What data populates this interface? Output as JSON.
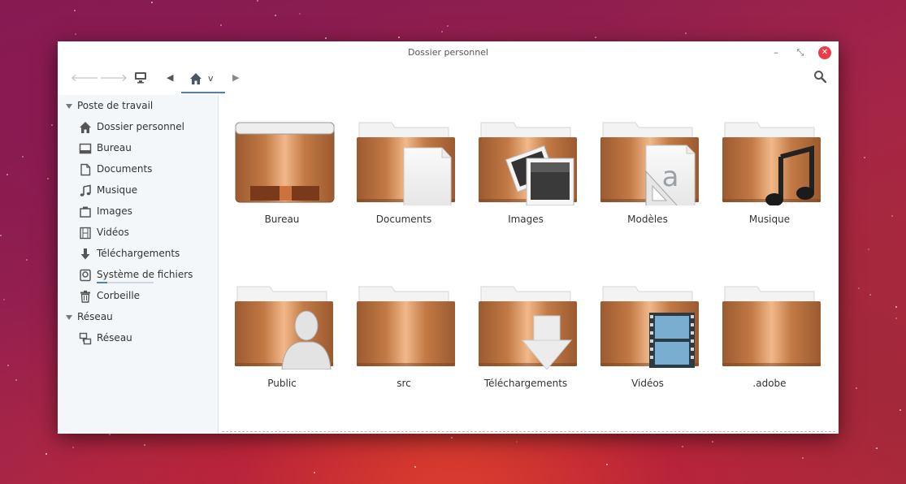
{
  "window": {
    "title": "Dossier personnel"
  },
  "toolbar": {
    "back_icon": "arrow-left-icon",
    "forward_icon": "arrow-right-icon",
    "computer_icon": "monitor-icon",
    "path_left_icon": "chevron-left-icon",
    "home_crumb_chevron": "v",
    "path_right_icon": "chevron-right-icon",
    "search_icon": "search-icon"
  },
  "sidebar": {
    "sections": [
      {
        "label": "Poste de travail"
      },
      {
        "label": "Réseau"
      }
    ],
    "items": [
      {
        "label": "Dossier personnel",
        "icon": "home-icon"
      },
      {
        "label": "Bureau",
        "icon": "desktop-icon"
      },
      {
        "label": "Documents",
        "icon": "document-icon"
      },
      {
        "label": "Musique",
        "icon": "music-note-icon"
      },
      {
        "label": "Images",
        "icon": "images-icon"
      },
      {
        "label": "Vidéos",
        "icon": "film-icon"
      },
      {
        "label": "Téléchargements",
        "icon": "download-arrow-icon"
      },
      {
        "label": "Système de fichiers",
        "icon": "drive-icon",
        "usage_fraction": 0.18
      },
      {
        "label": "Corbeille",
        "icon": "trash-icon"
      },
      {
        "label": "Réseau",
        "icon": "network-icon"
      }
    ]
  },
  "files": [
    {
      "label": "Bureau",
      "icon": "desktop-folder-icon"
    },
    {
      "label": "Documents",
      "icon": "documents-folder-icon"
    },
    {
      "label": "Images",
      "icon": "pictures-folder-icon"
    },
    {
      "label": "Modèles",
      "icon": "templates-folder-icon"
    },
    {
      "label": "Musique",
      "icon": "music-folder-icon"
    },
    {
      "label": "Public",
      "icon": "public-folder-icon"
    },
    {
      "label": "src",
      "icon": "folder-icon"
    },
    {
      "label": "Téléchargements",
      "icon": "downloads-folder-icon"
    },
    {
      "label": "Vidéos",
      "icon": "videos-folder-icon"
    },
    {
      "label": ".adobe",
      "icon": "folder-icon"
    }
  ],
  "colors": {
    "accent": "#4a7fc0",
    "folder_copper": "#c98550",
    "close_button": "#ef3b47"
  }
}
